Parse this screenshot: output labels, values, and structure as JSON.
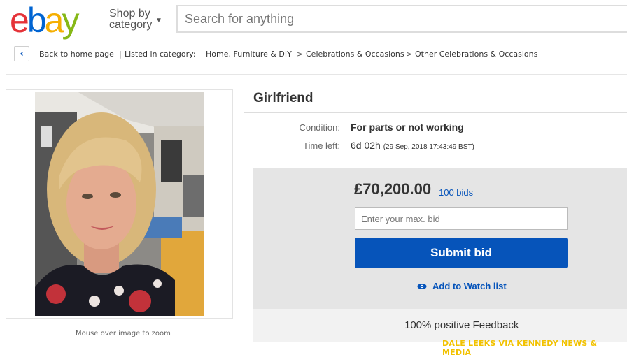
{
  "header": {
    "logo_letters": [
      {
        "ch": "e",
        "color": "#e53238"
      },
      {
        "ch": "b",
        "color": "#0064d2"
      },
      {
        "ch": "a",
        "color": "#f5af02"
      },
      {
        "ch": "y",
        "color": "#86b817"
      }
    ],
    "shop_by_line1": "Shop by",
    "shop_by_line2": "category",
    "search_placeholder": "Search for anything"
  },
  "breadcrumb": {
    "back_label": "Back to home page",
    "separator": "|",
    "listed_label": "Listed in category:",
    "categories": [
      "Home, Furniture & DIY",
      "Celebrations & Occasions",
      "Other Celebrations & Occasions"
    ],
    "arrow": ">"
  },
  "image_panel": {
    "zoom_note": "Mouse over image to zoom"
  },
  "item": {
    "title": "Girlfriend",
    "condition_label": "Condition:",
    "condition_value": "For parts or not working",
    "time_left_label": "Time left:",
    "time_left_value": "6d 02h",
    "time_left_detail": "(29 Sep, 2018   17:43:49 BST)"
  },
  "bid": {
    "price": "£70,200.00",
    "bids": "100 bids",
    "max_bid_placeholder": "Enter your max. bid",
    "submit_label": "Submit bid",
    "watch_label": "Add to Watch list"
  },
  "seller": {
    "feedback": "100% positive Feedback"
  },
  "credit": "DALE LEEKS VIA KENNEDY NEWS & MEDIA",
  "colors": {
    "link_blue": "#0654ba",
    "button_blue": "#0654ba",
    "bid_panel": "#e5e5e5"
  }
}
